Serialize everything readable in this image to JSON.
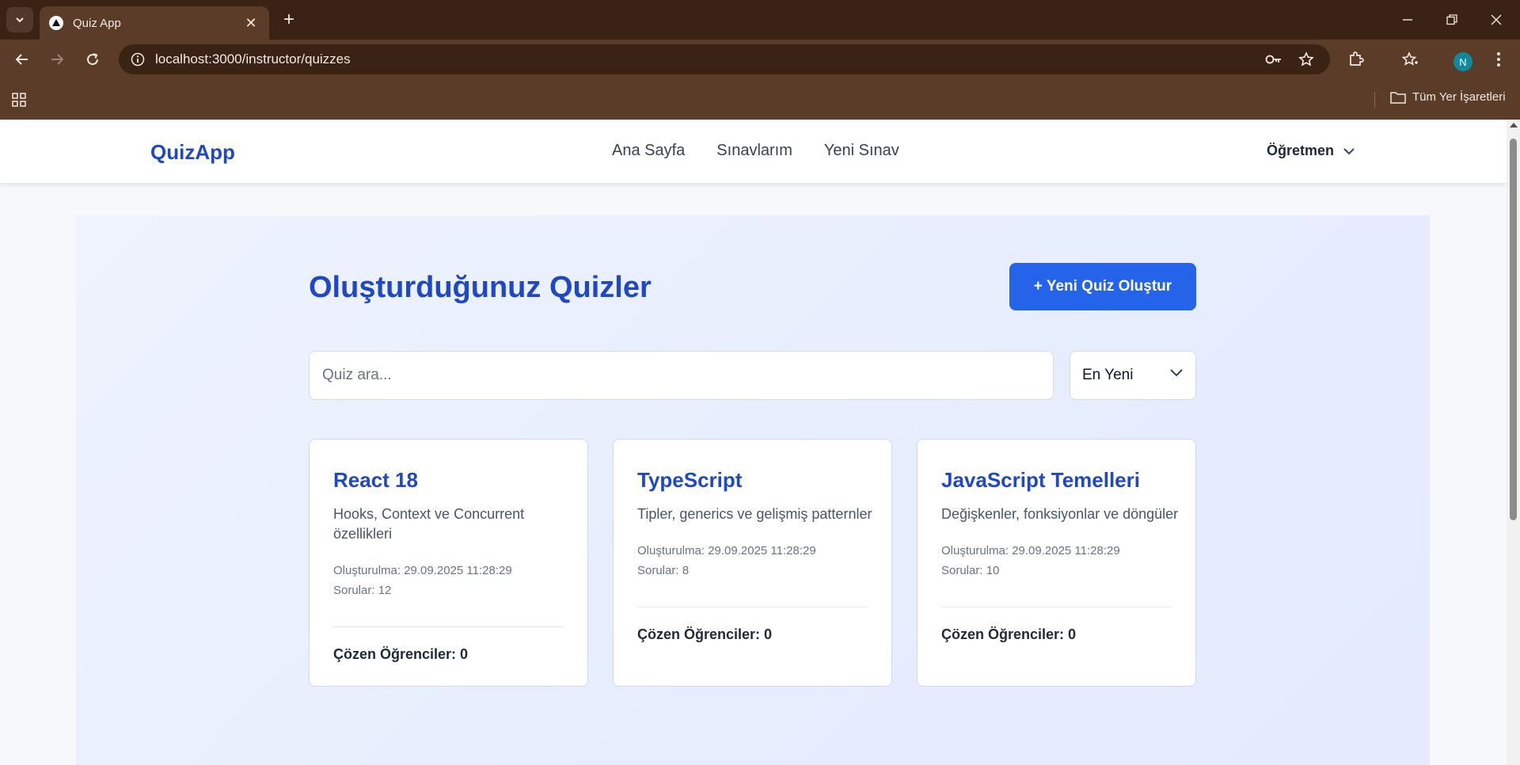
{
  "browser": {
    "tab_title": "Quiz App",
    "url": "localhost:3000/instructor/quizzes",
    "profile_initial": "N",
    "all_bookmarks_label": "Tüm Yer İşaretleri"
  },
  "navbar": {
    "brand": "QuizApp",
    "links": [
      "Ana Sayfa",
      "Sınavlarım",
      "Yeni Sınav"
    ],
    "user_label": "Öğretmen"
  },
  "page": {
    "title": "Oluşturduğunuz Quizler",
    "new_quiz_button": "+ Yeni Quiz Oluştur",
    "search_placeholder": "Quiz ara...",
    "sort_selected": "En Yeni"
  },
  "quizzes": [
    {
      "title": "React 18",
      "description": "Hooks, Context ve Concurrent özellikleri",
      "created": "Oluşturulma: 29.09.2025 11:28:29",
      "questions": "Sorular: 12",
      "solved": "Çözen Öğrenciler: 0"
    },
    {
      "title": "TypeScript",
      "description": "Tipler, generics ve gelişmiş patternler",
      "created": "Oluşturulma: 29.09.2025 11:28:29",
      "questions": "Sorular: 8",
      "solved": "Çözen Öğrenciler: 0"
    },
    {
      "title": "JavaScript Temelleri",
      "description": "Değişkenler, fonksiyonlar ve döngüler",
      "created": "Oluşturulma: 29.09.2025 11:28:29",
      "questions": "Sorular: 10",
      "solved": "Çözen Öğrenciler: 0"
    }
  ],
  "colors": {
    "brand_blue": "#1f48c9",
    "primary_button": "#2563eb",
    "chrome_dark": "#3a2314",
    "chrome_mid": "#5a3c28"
  }
}
